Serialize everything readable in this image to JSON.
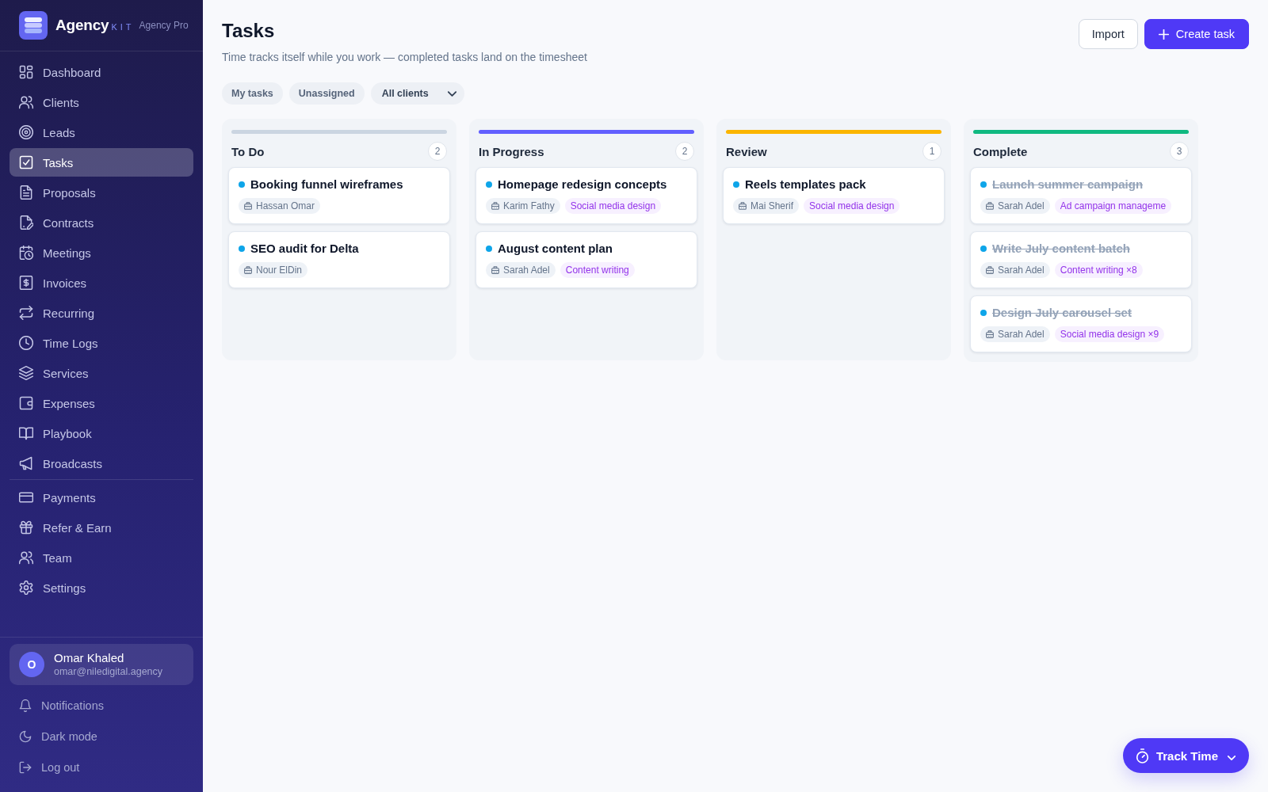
{
  "sidebar": {
    "brand": {
      "name": "Agency",
      "suffix": "KIT",
      "plan": "Agency Pro"
    },
    "nav_groups": [
      {
        "items": [
          {
            "label": "Dashboard",
            "selected": false
          },
          {
            "label": "Clients",
            "selected": false
          },
          {
            "label": "Leads",
            "selected": false
          },
          {
            "label": "Tasks",
            "selected": true
          },
          {
            "label": "Proposals",
            "selected": false
          },
          {
            "label": "Contracts",
            "selected": false
          },
          {
            "label": "Meetings",
            "selected": false
          },
          {
            "label": "Invoices",
            "selected": false
          },
          {
            "label": "Recurring",
            "selected": false
          },
          {
            "label": "Time Logs",
            "selected": false
          },
          {
            "label": "Services",
            "selected": false
          },
          {
            "label": "Expenses",
            "selected": false
          },
          {
            "label": "Playbook",
            "selected": false
          },
          {
            "label": "Broadcasts",
            "selected": false
          }
        ]
      },
      {
        "items": [
          {
            "label": "Payments",
            "selected": false
          },
          {
            "label": "Refer & Earn",
            "selected": false
          },
          {
            "label": "Team",
            "selected": false
          },
          {
            "label": "Settings",
            "selected": false
          }
        ]
      }
    ],
    "user": {
      "initial": "O",
      "name": "Omar Khaled",
      "email": "omar@niledigital.agency"
    },
    "footer_items": [
      {
        "label": "Notifications"
      },
      {
        "label": "Dark mode"
      },
      {
        "label": "Log out"
      }
    ]
  },
  "header": {
    "title": "Tasks",
    "subtitle": "Time tracks itself while you work — completed tasks land on the timesheet",
    "buttons": [
      {
        "kind": "secondary",
        "label": "Import"
      },
      {
        "kind": "primary",
        "label": "Create task"
      }
    ]
  },
  "filters": [
    {
      "kind": "pill",
      "label": "My tasks",
      "selected": false
    },
    {
      "kind": "pill",
      "label": "Unassigned",
      "selected": false
    },
    {
      "kind": "dropdown",
      "label": "All clients"
    }
  ],
  "board": {
    "columns": [
      {
        "title": "To Do",
        "count": "2",
        "color": "#cbd5e1",
        "cards": [
          {
            "title": "Booking funnel wireframes",
            "done": false,
            "client": "Hassan Omar"
          },
          {
            "title": "SEO audit for Delta",
            "done": false,
            "client": "Nour ElDin"
          }
        ]
      },
      {
        "title": "In Progress",
        "count": "2",
        "color": "#625fff",
        "cards": [
          {
            "title": "Homepage redesign concepts",
            "done": false,
            "client": "Karim Fathy",
            "service": "Social media design"
          },
          {
            "title": "August content plan",
            "done": false,
            "client": "Sarah Adel",
            "service": "Content writing"
          }
        ]
      },
      {
        "title": "Review",
        "count": "1",
        "color": "#fbb500",
        "cards": [
          {
            "title": "Reels templates pack",
            "done": false,
            "client": "Mai Sherif",
            "service": "Social media design"
          }
        ]
      },
      {
        "title": "Complete",
        "count": "3",
        "color": "#10b981",
        "cards": [
          {
            "title": "Launch summer campaign",
            "done": true,
            "client": "Sarah Adel",
            "service": "Ad campaign manageme"
          },
          {
            "title": "Write July content batch",
            "done": true,
            "client": "Sarah Adel",
            "service": "Content writing ×8"
          },
          {
            "title": "Design July carousel set",
            "done": true,
            "client": "Sarah Adel",
            "service": "Social media design ×9"
          }
        ]
      }
    ]
  },
  "track_time": {
    "label": "Track Time"
  }
}
